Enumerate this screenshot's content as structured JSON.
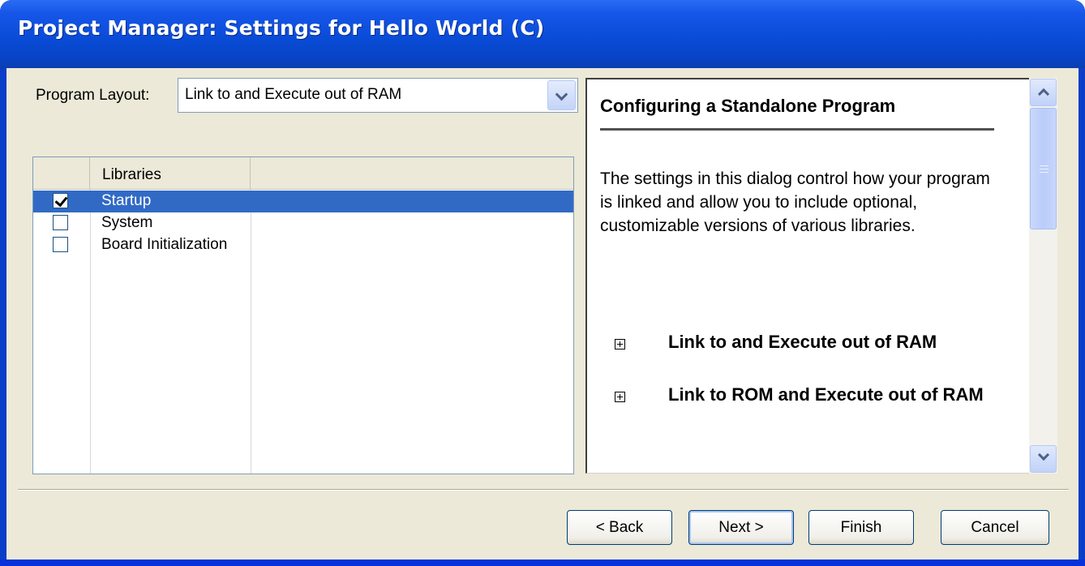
{
  "window": {
    "title": "Project Manager: Settings for Hello World (C)"
  },
  "program_layout": {
    "label": "Program Layout:",
    "selected": "Link to and Execute out of RAM"
  },
  "libraries": {
    "column_header": "Libraries",
    "items": [
      {
        "label": "Startup",
        "checked": true,
        "selected": true
      },
      {
        "label": "System",
        "checked": false,
        "selected": false
      },
      {
        "label": "Board Initialization",
        "checked": false,
        "selected": false
      }
    ]
  },
  "help": {
    "heading": "Configuring a Standalone Program",
    "body": "The settings in this dialog control how your program is linked and allow you to include optional, customizable versions of various libraries.",
    "sections": [
      "Link to and Execute out of RAM",
      "Link to ROM and Execute out of RAM"
    ]
  },
  "buttons": {
    "back": "< Back",
    "next": "Next >",
    "finish": "Finish",
    "cancel": "Cancel"
  },
  "colors": {
    "titlebar": "#0a4cd8",
    "selection": "#316ac5",
    "dialog_bg": "#ece9d8"
  }
}
